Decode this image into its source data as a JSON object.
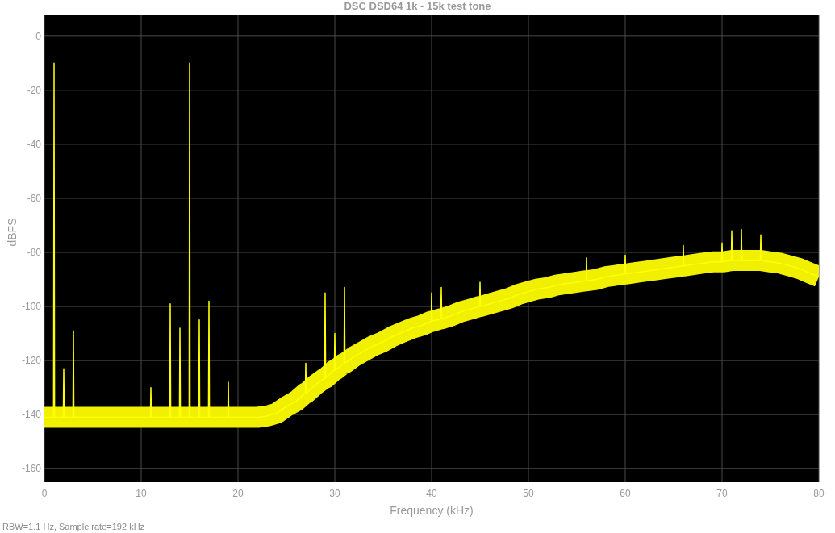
{
  "chart": {
    "chart_data": {
      "type": "line",
      "title": "DSC DSD64 1k - 15k  test tone",
      "xlabel": "Frequency (kHz)",
      "ylabel": "dBFS",
      "x": [
        0,
        0.95,
        1,
        1.05,
        1.95,
        2,
        2.05,
        2.95,
        3,
        3.05,
        4,
        5,
        6,
        7,
        8,
        9,
        10,
        10.95,
        11,
        11.05,
        12,
        12.95,
        13,
        13.05,
        13.95,
        14,
        14.05,
        14.95,
        15,
        15.05,
        15.95,
        16,
        16.05,
        16.95,
        17,
        17.05,
        18,
        18.95,
        19,
        19.05,
        20,
        21,
        22,
        23,
        24,
        25,
        26,
        26.95,
        27,
        27.05,
        28,
        28.95,
        29,
        29.05,
        29.95,
        30,
        30.05,
        30.95,
        31,
        31.05,
        32,
        33,
        34,
        35,
        36,
        37,
        38,
        39,
        39.95,
        40,
        40.05,
        40.95,
        41,
        41.05,
        42,
        43,
        44,
        44.95,
        45,
        45.05,
        46,
        47,
        48,
        49,
        50,
        51,
        52,
        53,
        54,
        55,
        55.95,
        56,
        56.05,
        57,
        58,
        59,
        59.95,
        60,
        60.05,
        61,
        62,
        63,
        64,
        65,
        65.95,
        66,
        66.05,
        67,
        68,
        69,
        69.95,
        70,
        70.05,
        70.95,
        71,
        71.05,
        71.95,
        72,
        72.05,
        73,
        73.95,
        74,
        74.05,
        75,
        76,
        77,
        78,
        79,
        80
      ],
      "series": [
        {
          "color": "#ffff00",
          "values": [
            -141,
            -141,
            -10,
            -141,
            -141,
            -123,
            -141,
            -141,
            -109,
            -141,
            -141,
            -141,
            -141,
            -141,
            -141,
            -141,
            -141,
            -141,
            -130,
            -141,
            -141,
            -141,
            -99,
            -141,
            -141,
            -108,
            -141,
            -141,
            -10,
            -141,
            -141,
            -105,
            -141,
            -141,
            -98,
            -141,
            -141,
            -141,
            -128,
            -141,
            -141,
            -141,
            -141,
            -140.5,
            -139.5,
            -137,
            -135,
            -132,
            -121,
            -132,
            -129,
            -126.5,
            -95,
            -126.5,
            -123.5,
            -110,
            -123.5,
            -121,
            -93,
            -121,
            -118.5,
            -116.5,
            -114.5,
            -113,
            -111,
            -109.5,
            -108,
            -107,
            -105.5,
            -95,
            -105.5,
            -104.5,
            -93,
            -104.5,
            -103.5,
            -102,
            -101,
            -100,
            -91,
            -100,
            -99,
            -98,
            -97,
            -95.5,
            -94.5,
            -93.5,
            -93,
            -92,
            -91.5,
            -91,
            -90.5,
            -82,
            -90.5,
            -90,
            -89,
            -88.5,
            -88,
            -81,
            -88,
            -87.5,
            -87,
            -86.5,
            -86,
            -85.5,
            -85,
            -77.5,
            -85,
            -84.5,
            -84,
            -83.5,
            -83.5,
            -76.5,
            -83.5,
            -83,
            -72,
            -83,
            -83,
            -71.5,
            -83,
            -83,
            -83,
            -73.5,
            -83,
            -83.5,
            -84,
            -85,
            -86,
            -87.5,
            -89
          ]
        },
        {
          "color": "#f0f000",
          "values": [
            -141,
            -141,
            -141,
            -141,
            -141,
            -141,
            -141,
            -141,
            -141,
            -141,
            -141,
            -141,
            -141,
            -141,
            -141,
            -141,
            -141,
            -141,
            -141,
            -141,
            -141,
            -141,
            -141,
            -141,
            -141,
            -141,
            -141,
            -141,
            -141,
            -141,
            -141,
            -141,
            -141,
            -141,
            -141,
            -141,
            -141,
            -141,
            -141,
            -141,
            -141,
            -141,
            -141,
            -140.5,
            -139.5,
            -137,
            -135,
            -132,
            -132,
            -132,
            -129,
            -126.5,
            -126.5,
            -126.5,
            -123.5,
            -123.5,
            -123.5,
            -121,
            -121,
            -121,
            -118.5,
            -116.5,
            -114.5,
            -113,
            -111,
            -109.5,
            -108,
            -107,
            -105.5,
            -105.5,
            -105.5,
            -104.5,
            -104.5,
            -104.5,
            -103.5,
            -102,
            -101,
            -100,
            -100,
            -100,
            -99,
            -98,
            -97,
            -95.5,
            -94.5,
            -93.5,
            -93,
            -92,
            -91.5,
            -91,
            -90.5,
            -90.5,
            -90.5,
            -90,
            -89,
            -88.5,
            -88,
            -88,
            -88,
            -87.5,
            -87,
            -86.5,
            -86,
            -85.5,
            -85,
            -85,
            -85,
            -84.5,
            -84,
            -83.5,
            -83.5,
            -83.5,
            -83.5,
            -83,
            -83,
            -83,
            -83,
            -83,
            -83,
            -83,
            -83,
            -83,
            -83,
            -83.5,
            -84,
            -85,
            -86,
            -87.5,
            -89
          ]
        }
      ],
      "xlim": [
        0,
        80
      ],
      "ylim": [
        -165,
        8
      ],
      "xticks": [
        0,
        10,
        20,
        30,
        40,
        50,
        60,
        70,
        80
      ],
      "yticks": [
        0,
        -20,
        -40,
        -60,
        -80,
        -100,
        -120,
        -140,
        -160
      ],
      "grid": true
    }
  },
  "footer": "RBW=1.1 Hz, Sample rate=192 kHz"
}
